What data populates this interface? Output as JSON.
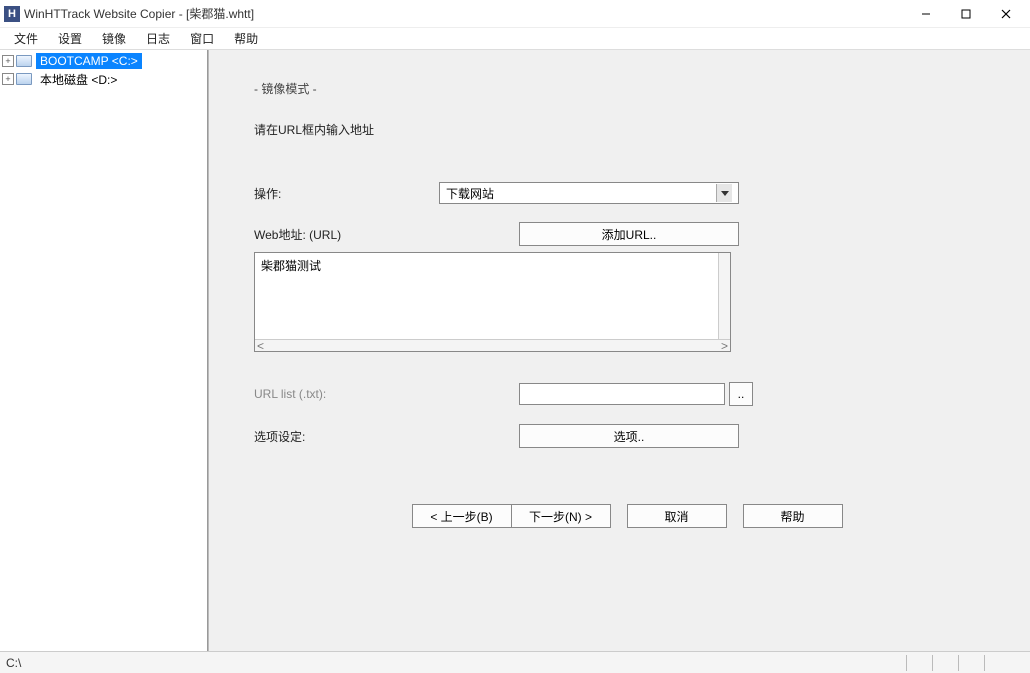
{
  "title": "WinHTTrack Website Copier - [柴郡猫.whtt]",
  "app_icon_letter": "H",
  "window_controls": {
    "min": "–",
    "max": "☐",
    "close": "✕"
  },
  "menu": [
    "文件",
    "设置",
    "镜像",
    "日志",
    "窗口",
    "帮助"
  ],
  "tree": [
    {
      "toggle": "+",
      "label": "BOOTCAMP <C:>",
      "selected": true
    },
    {
      "toggle": "+",
      "label": "本地磁盘 <D:>",
      "selected": false
    }
  ],
  "panel": {
    "mode_title": "- 镜像模式 -",
    "mode_hint": "请在URL框内输入地址",
    "action_label": "操作:",
    "action_value": "下载网站",
    "web_url_label": "Web地址: (URL)",
    "add_url_btn": "添加URL..",
    "url_textarea_value": "柴郡猫测试",
    "url_list_label": "URL list (.txt):",
    "url_list_value": "",
    "browse_btn": "..",
    "options_label": "选项设定:",
    "options_btn": "选项..",
    "prev_btn": "< 上一步(B)",
    "next_btn": "下一步(N) >",
    "cancel_btn": "取消",
    "help_btn": "帮助"
  },
  "statusbar": "C:\\"
}
